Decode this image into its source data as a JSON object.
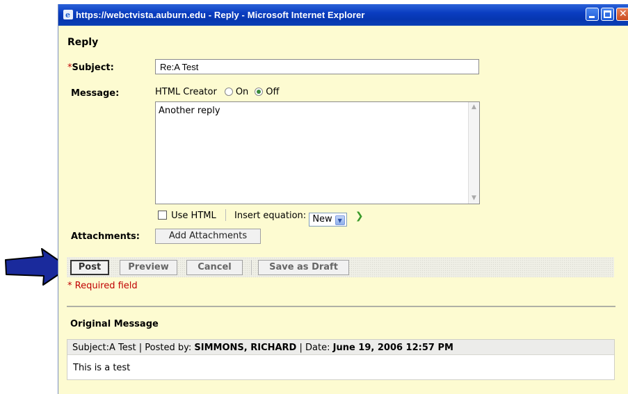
{
  "window": {
    "title": "https://webctvista.auburn.edu - Reply - Microsoft Internet Explorer"
  },
  "form": {
    "heading": "Reply",
    "required_marker": "*",
    "subject_label": "Subject:",
    "subject_value": "Re:A Test",
    "message_label": "Message:",
    "html_creator_label": "HTML Creator",
    "radio_on_label": "On",
    "radio_off_label": "Off",
    "html_creator_selected": "Off",
    "message_value": "Another reply",
    "use_html_label": "Use HTML",
    "use_html_checked": false,
    "insert_equation_label": "Insert equation:",
    "insert_equation_selected": "New",
    "attachments_label": "Attachments:",
    "add_attachments_label": "Add Attachments"
  },
  "actions": {
    "post": "Post",
    "preview": "Preview",
    "cancel": "Cancel",
    "save_draft": "Save as Draft"
  },
  "required_note": "* Required field",
  "original": {
    "heading": "Original Message",
    "subject_key": "Subject:",
    "subject": "A Test",
    "posted_by_key": "Posted by:",
    "posted_by": "SIMMONS, RICHARD",
    "date_key": "Date:",
    "date": "June 19, 2006 12:57 PM",
    "body": "This is a test"
  },
  "colors": {
    "window_bg": "#fdfbd1",
    "titlebar": "#0a3dc1",
    "required": "#c00000",
    "annotation_arrow": "#1a2a9c"
  },
  "icons": [
    "ie-icon",
    "minimize-icon",
    "maximize-icon",
    "close-icon",
    "chevron-down-icon",
    "go-arrow-icon",
    "annotation-arrow"
  ]
}
